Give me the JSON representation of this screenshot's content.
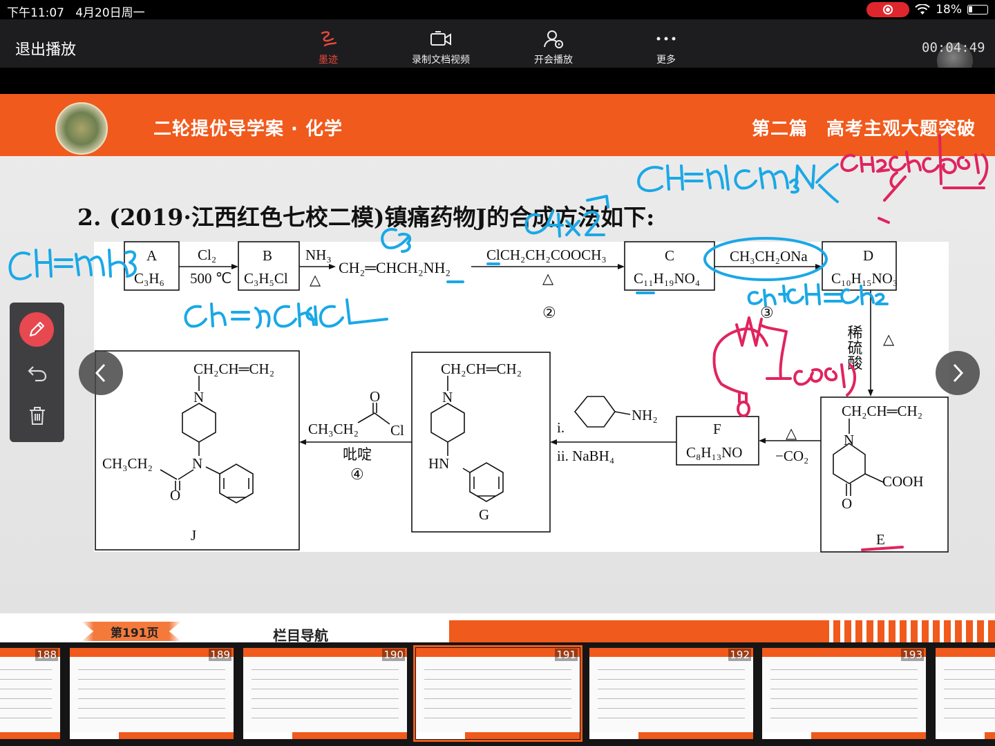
{
  "status_bar": {
    "time": "下午11:07",
    "date": "4月20日周一",
    "battery": "18%"
  },
  "toolbar": {
    "exit_label": "退出播放",
    "tools": [
      {
        "label": "墨迹",
        "icon": "ink-icon",
        "active": true
      },
      {
        "label": "录制文档视频",
        "icon": "record-video-icon"
      },
      {
        "label": "开会播放",
        "icon": "meeting-icon"
      },
      {
        "label": "更多",
        "icon": "more-icon"
      }
    ],
    "timer": "00:04:49"
  },
  "slide": {
    "header_left": "二轮提优导学案 · 化学",
    "header_right": "第二篇　高考主观大题突破",
    "question": "2. (2019·江西红色七校二模)镇痛药物J的合成方法如下:",
    "compounds": {
      "A": {
        "label": "A",
        "formula": "C₃H₆"
      },
      "B": {
        "label": "B",
        "formula": "C₃H₅Cl"
      },
      "C": {
        "label": "C",
        "formula": "C₁₁H₁₉NO₄"
      },
      "D": {
        "label": "D",
        "formula": "C₁₀H₁₅NO₃"
      },
      "E": {
        "label": "E"
      },
      "F": {
        "label": "F",
        "formula": "C₈H₁₃NO"
      },
      "G": {
        "label": "G"
      },
      "J": {
        "label": "J"
      }
    },
    "reagents": {
      "cl2": "Cl₂",
      "temp": "500 ℃",
      "nh3": "NH₃",
      "heat": "△",
      "amine": "CH₂═CHCH₂NH₂",
      "ester": "ClCH₂CH₂COOCH₃",
      "step2": "②",
      "ethoxide": "CH₃CH₂ONa",
      "step3": "③",
      "acid": "稀硫酸",
      "decarb": "−CO₂",
      "aniline_nh2": "NH₂",
      "step_i": "i.",
      "step_ii": "ii. NaBH₄",
      "acyl_ch3ch2": "CH₃CH₂",
      "acyl_o": "O",
      "acyl_cl": "Cl",
      "pyridine": "吡啶",
      "step4": "④"
    },
    "structures": {
      "allyl": "CH₂CH═CH₂",
      "n": "N",
      "hn": "HN",
      "o": "O",
      "cooh": "COOH",
      "ethyl": "CH₃CH₂"
    }
  },
  "bottom_bar": {
    "page": "第191页",
    "nav": "栏目导航"
  },
  "thumbnails": [
    {
      "num": "188"
    },
    {
      "num": "189"
    },
    {
      "num": "190"
    },
    {
      "num": "191",
      "active": true
    },
    {
      "num": "192"
    },
    {
      "num": "193"
    },
    {
      "num": ""
    }
  ],
  "colors": {
    "accent": "#f05a1c",
    "ink_blue": "#1aa8e6",
    "ink_red": "#e0245e",
    "record": "#e0262d"
  }
}
